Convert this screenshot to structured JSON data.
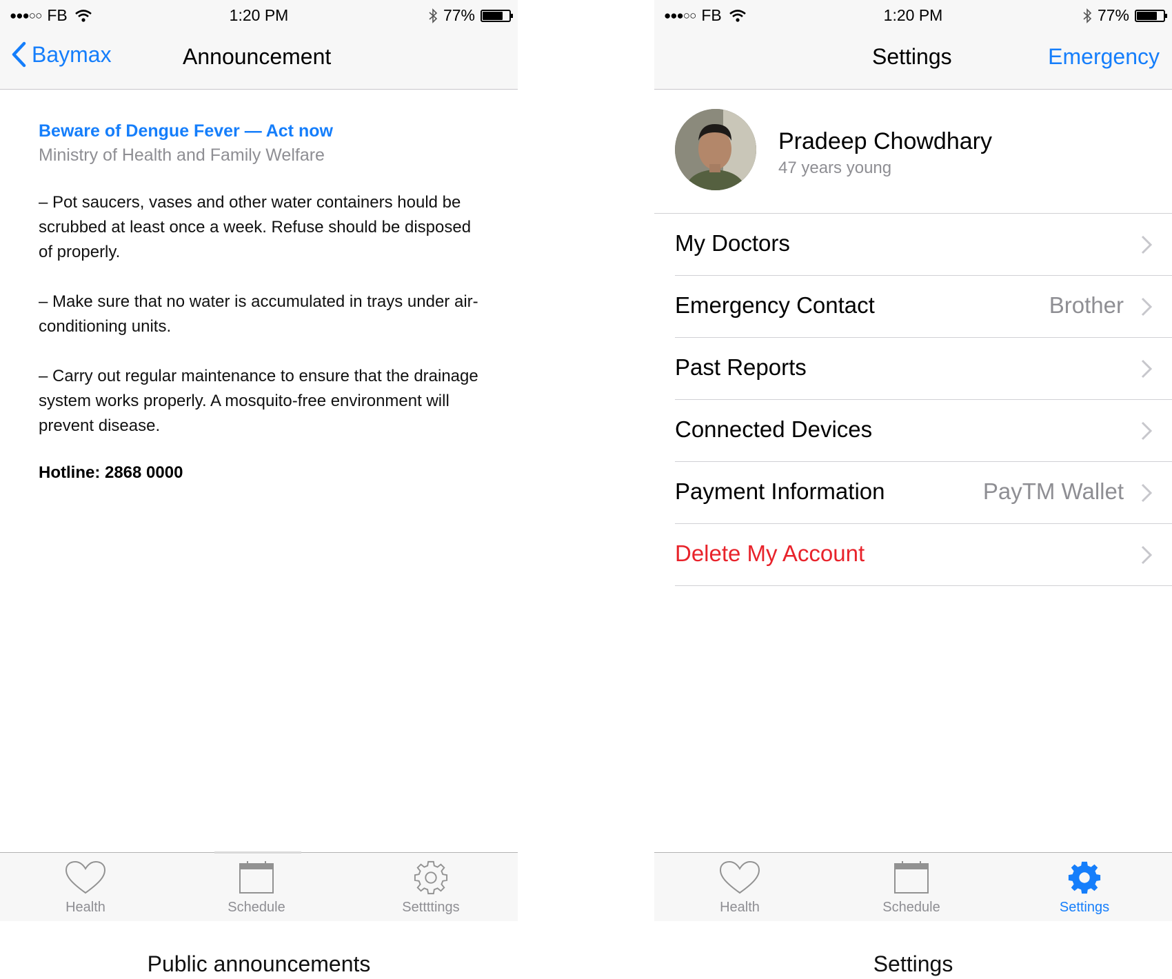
{
  "status_bar": {
    "carrier": "FB",
    "time": "1:20 PM",
    "battery": "77%",
    "battery_level": 0.77
  },
  "left_screen": {
    "nav": {
      "back_label": "Baymax",
      "title": "Announcement"
    },
    "announcement": {
      "title": "Beware of Dengue Fever — Act now",
      "source": "Ministry of Health and Family Welfare",
      "paragraphs": [
        "– Pot saucers, vases and other water containers hould be scrubbed at least once a week. Refuse should be disposed of properly.",
        "– Make sure that no water is accumulated in trays under air-conditioning units.",
        "– Carry out regular maintenance to ensure that the drainage system works properly. A mosquito-free environment will prevent disease."
      ],
      "hotline": "Hotline: 2868 0000"
    },
    "tabs": [
      {
        "label": "Health",
        "icon": "heart-icon"
      },
      {
        "label": "Schedule",
        "icon": "calendar-icon"
      },
      {
        "label": "Settttings",
        "icon": "gear-outline-icon"
      }
    ],
    "caption": "Public announcements"
  },
  "right_screen": {
    "nav": {
      "title": "Settings",
      "action_label": "Emergency"
    },
    "profile": {
      "name": "Pradeep Chowdhary",
      "subtitle": "47 years young"
    },
    "rows": [
      {
        "label": "My Doctors",
        "value": ""
      },
      {
        "label": "Emergency Contact",
        "value": "Brother"
      },
      {
        "label": "Past Reports",
        "value": ""
      },
      {
        "label": "Connected Devices",
        "value": ""
      },
      {
        "label": "Payment Information",
        "value": "PayTM Wallet"
      },
      {
        "label": "Delete My Account",
        "value": ""
      }
    ],
    "tabs": [
      {
        "label": "Health",
        "icon": "heart-icon"
      },
      {
        "label": "Schedule",
        "icon": "calendar-icon"
      },
      {
        "label": "Settings",
        "icon": "gear-filled-icon"
      }
    ],
    "caption": "Settings"
  },
  "colors": {
    "accent": "#157efb",
    "danger": "#e8232b",
    "secondary_text": "#8e8e93",
    "bar_background": "#f7f7f7"
  }
}
